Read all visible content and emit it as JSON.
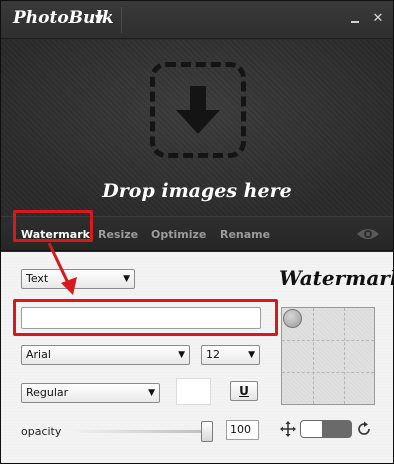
{
  "app": {
    "title": "PhotoBulk",
    "menu_caret": "▼",
    "minimize_icon": "minimize-icon",
    "close_icon": "close-icon",
    "close_glyph": "✕"
  },
  "dropzone": {
    "text": "Drop images here",
    "icon": "download-arrow-icon"
  },
  "tabs": [
    {
      "label": "Watermark",
      "active": true
    },
    {
      "label": "Resize",
      "active": false
    },
    {
      "label": "Optimize",
      "active": false
    },
    {
      "label": "Rename",
      "active": false
    }
  ],
  "preview_toggle_icon": "eye-icon",
  "watermark": {
    "heading": "Watermark",
    "type_select": "Text",
    "text_value": "",
    "font_select": "Arial",
    "size_select": "12",
    "style_select": "Regular",
    "underline_label": "U",
    "opacity_label": "opacity",
    "opacity_value": "100",
    "color_swatch": "#ffffff"
  },
  "annotation_color": "#d5191e",
  "select_caret": "▼"
}
